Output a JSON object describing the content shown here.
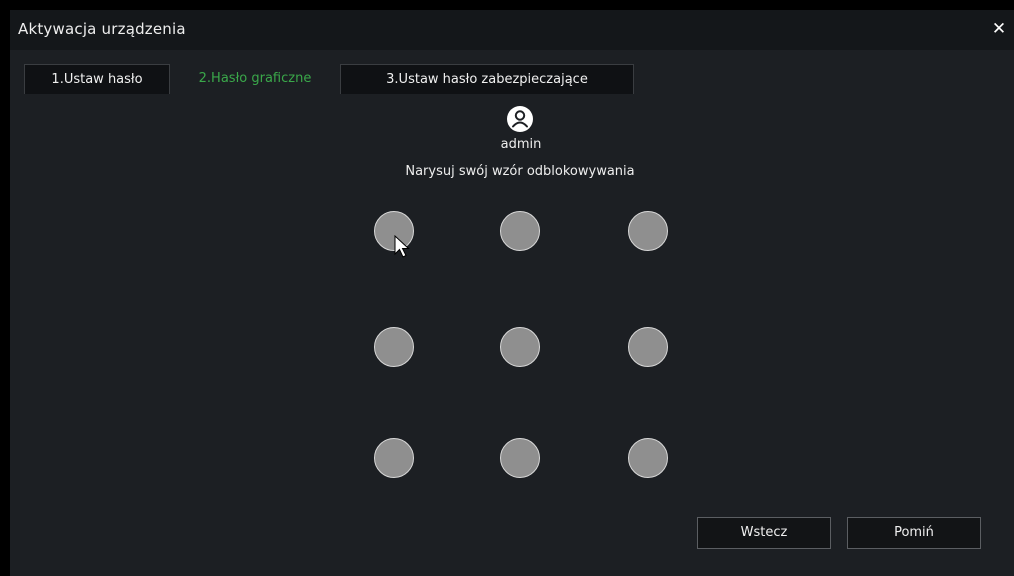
{
  "dialog": {
    "title": "Aktywacja urządzenia",
    "close_symbol": "✕"
  },
  "tabs": [
    {
      "label": "1.Ustaw hasło",
      "active": false
    },
    {
      "label": "2.Hasło graficzne",
      "active": true
    },
    {
      "label": "3.Ustaw hasło zabezpieczające",
      "active": false
    }
  ],
  "user": {
    "icon": "user-avatar-icon",
    "name": "admin"
  },
  "pattern": {
    "instruction": "Narysuj swój wzór odblokowywania",
    "dot_count": 9
  },
  "buttons": {
    "back_label": "Wstecz",
    "skip_label": "Pomiń"
  },
  "colors": {
    "background": "#1c1f23",
    "active_tab": "#3aa84a",
    "dot_fill": "#8f8f8f"
  }
}
